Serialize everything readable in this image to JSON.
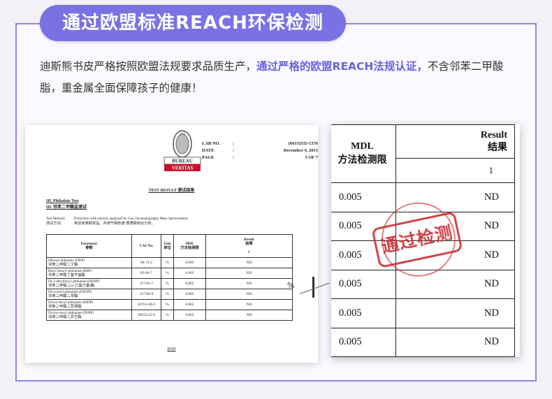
{
  "banner": {
    "title": "通过欧盟标准REACH环保检测"
  },
  "intro": {
    "text_before": "迪斯熊书皮严格按照欧盟法规要求品质生产，",
    "highlight": "通过严格的欧盟REACH法规认证，",
    "text_after": "不含邻苯二甲酸脂，重金属全面保障孩子的健康！"
  },
  "report": {
    "logo_top": "BUREAU",
    "logo_bottom": "VERITAS",
    "logo_year": "1828",
    "lab_rows": [
      {
        "label": "LAB NO.",
        "sep": ":",
        "value": "(6615)335-1376"
      },
      {
        "label": "DATE",
        "sep": ":",
        "value": "December 4, 2015"
      },
      {
        "label": "PAGE",
        "sep": ":",
        "value": "5  OF  7"
      }
    ],
    "title": "TEST RESULT 测试结果",
    "section_en": "III. Phthalate Test",
    "section_cn": "III. 邻苯二甲酸盐测试",
    "method_label_en": "Test Method:",
    "method_label_cn": "测试方法:",
    "method_text_en": "Extraction with solvent, analysed by Gas Chromatography Mass Spectrometer.",
    "method_text_cn": "用溶液萃取样品，并用气相色谱-质谱联用仪分析。",
    "table_headers": {
      "param_en": "Parameter",
      "param_cn": "参数",
      "cas": "CAS No.",
      "unit_en": "Unit",
      "unit_cn": "单位",
      "mdl_en": "MDL",
      "mdl_cn": "方法检测限",
      "result_en": "Result",
      "result_cn": "结果",
      "result_no": "1"
    },
    "rows": [
      {
        "param_en": "Dibutyl phthalate (DBP)",
        "param_cn": "邻苯二甲酸二丁酯",
        "cas": "84-74-2",
        "unit": "%",
        "mdl": "0.005",
        "result": "ND"
      },
      {
        "param_en": "Butyl benzyl phthalate (BBP)",
        "param_cn": "邻苯二甲酸丁基苄基酯",
        "cas": "85-68-7",
        "unit": "%",
        "mdl": "0.005",
        "result": "ND"
      },
      {
        "param_en": "Di-2-ethylhexyl phthalate (DEHP)",
        "param_cn": "邻苯二甲酸二(2-乙基己基)酯",
        "cas": "117-81-7",
        "unit": "%",
        "mdl": "0.005",
        "result": "ND"
      },
      {
        "param_en": "Di-n-octyl phthalate (DNOP)",
        "param_cn": "邻苯二甲酸二辛酯",
        "cas": "117-84-0",
        "unit": "%",
        "mdl": "0.005",
        "result": "ND"
      },
      {
        "param_en": "Di-iso-decyl phthalate (DIDP)",
        "param_cn": "邻苯二甲酸二异癸酯",
        "cas": "26761-40-0",
        "unit": "%",
        "mdl": "0.005",
        "result": "ND"
      },
      {
        "param_en": "Di-iso-nonyl phthalate (DINP)",
        "param_cn": "邻苯二甲酸二异壬酯",
        "cas": "28553-12-0",
        "unit": "%",
        "mdl": "0.005",
        "result": "ND"
      }
    ],
    "end": "END"
  },
  "callout_unit": "%",
  "zoom": {
    "mdl_en": "MDL",
    "mdl_cn": "方法检测限",
    "result_en": "Result",
    "result_cn": "结果",
    "result_no": "1",
    "rows": [
      {
        "mdl": "0.005",
        "result": "ND"
      },
      {
        "mdl": "0.005",
        "result": "ND"
      },
      {
        "mdl": "0.005",
        "result": "ND"
      },
      {
        "mdl": "0.005",
        "result": "ND"
      },
      {
        "mdl": "0.005",
        "result": "ND"
      },
      {
        "mdl": "0.005",
        "result": "ND"
      }
    ]
  },
  "stamp": {
    "text": "通过检测"
  },
  "colors": {
    "accent": "#7a72e4",
    "highlight": "#6a60e0",
    "stamp": "#cc2a2e",
    "logo_red": "#c8102e"
  }
}
